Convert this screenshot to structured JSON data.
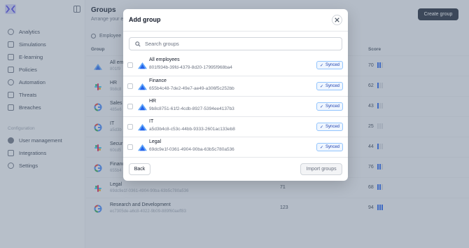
{
  "sidebar": {
    "nav": [
      {
        "label": "Analytics",
        "icon": "analytics-icon"
      },
      {
        "label": "Simulations",
        "icon": "simulations-icon"
      },
      {
        "label": "E-learning",
        "icon": "elearning-icon"
      },
      {
        "label": "Policies",
        "icon": "policies-icon"
      },
      {
        "label": "Automation",
        "icon": "automation-icon"
      },
      {
        "label": "Threats",
        "icon": "threats-icon"
      },
      {
        "label": "Breaches",
        "icon": "breaches-icon"
      }
    ],
    "section_label": "Configuration",
    "config_nav": [
      {
        "label": "User management",
        "icon": "users-icon"
      },
      {
        "label": "Integrations",
        "icon": "integrations-icon"
      },
      {
        "label": "Settings",
        "icon": "settings-icon"
      }
    ]
  },
  "main": {
    "title": "Groups",
    "subtitle": "Arrange your e",
    "create_button": "Create group",
    "employees_tab": "Employee",
    "columns": {
      "group": "Group",
      "score": "Score"
    },
    "rows": [
      {
        "name": "All em",
        "id": "801f9",
        "count": "",
        "score": "70",
        "icon": "azure",
        "bars_on": 2
      },
      {
        "name": "HR",
        "id": "9b8c8",
        "count": "",
        "score": "62",
        "icon": "slack",
        "bars_on": 1
      },
      {
        "name": "Sales",
        "id": "485e6",
        "count": "",
        "score": "43",
        "icon": "google",
        "bars_on": 1
      },
      {
        "name": "IT",
        "id": "a5d3b",
        "count": "",
        "score": "25",
        "icon": "google",
        "bars_on": 0
      },
      {
        "name": "Secur",
        "id": "60cd5",
        "count": "",
        "score": "44",
        "icon": "slack",
        "bars_on": 1
      },
      {
        "name": "Financ",
        "id": "655b4",
        "count": "",
        "score": "76",
        "icon": "google",
        "bars_on": 2
      },
      {
        "name": "Legal",
        "id": "69dc9e1f-0361-4904-90ba-63b5c780a536",
        "count": "71",
        "score": "68",
        "icon": "slack",
        "bars_on": 2
      },
      {
        "name": "Research and Development",
        "id": "ec7305de-a6c8-4022-9b09-889f60aeff83",
        "count": "123",
        "score": "94",
        "icon": "google",
        "bars_on": 3
      }
    ]
  },
  "modal": {
    "title": "Add group",
    "close_icon": "close-icon",
    "search_placeholder": "Search groups",
    "groups": [
      {
        "name": "All employees",
        "guid": "801f934b-39fd-4379-8d20-17995f968ba4",
        "status": "Synced"
      },
      {
        "name": "Finance",
        "guid": "655b4c48-7de2-49e7-ae49-a306f5c252bb",
        "status": "Synced"
      },
      {
        "name": "HR",
        "guid": "9b8c8751-61f2-4cdb-8927-5394ee4137b3",
        "status": "Synced"
      },
      {
        "name": "IT",
        "guid": "a5d3b4c8-c53c-44bb-9333-2601ac133eb8",
        "status": "Synced"
      },
      {
        "name": "Legal",
        "guid": "69dc9e1f-0361-4904-90ba-63b5c780a536",
        "status": "Synced"
      }
    ],
    "back_button": "Back",
    "import_button": "Import groups"
  },
  "colors": {
    "azure": "#3b82f6",
    "badge_border": "#93c5fd",
    "primary_dark": "#1f2937"
  }
}
